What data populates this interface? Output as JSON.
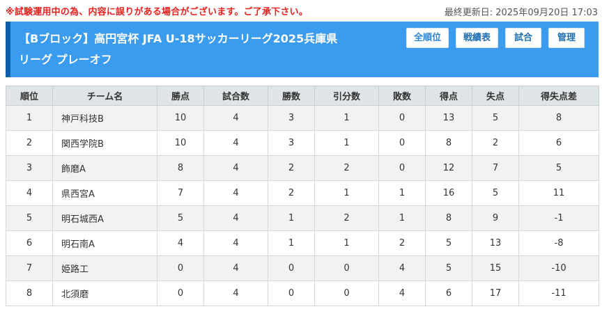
{
  "notice": "※試験運用中の為、内容に誤りがある場合がございます。ご了承下さい。",
  "last_updated": "最終更新日: 2025年09月20日 17:03",
  "header": {
    "title_line1": "【Bブロック】高円宮杯 JFA U-18サッカーリーグ2025兵庫県",
    "title_line2": "リーグ プレーオフ"
  },
  "nav": {
    "standings": "全順位",
    "results": "戦績表",
    "matches": "試合",
    "admin": "管理"
  },
  "table": {
    "headers": [
      "順位",
      "チーム名",
      "勝点",
      "試合数",
      "勝数",
      "引分数",
      "敗数",
      "得点",
      "失点",
      "得失点差"
    ],
    "rows": [
      [
        "1",
        "神戸科技B",
        "10",
        "4",
        "3",
        "1",
        "0",
        "13",
        "5",
        "8"
      ],
      [
        "2",
        "関西学院B",
        "10",
        "4",
        "3",
        "1",
        "0",
        "8",
        "2",
        "6"
      ],
      [
        "3",
        "飾磨A",
        "8",
        "4",
        "2",
        "2",
        "0",
        "12",
        "7",
        "5"
      ],
      [
        "4",
        "県西宮A",
        "7",
        "4",
        "2",
        "1",
        "1",
        "16",
        "5",
        "11"
      ],
      [
        "5",
        "明石城西A",
        "5",
        "4",
        "1",
        "2",
        "1",
        "8",
        "9",
        "-1"
      ],
      [
        "6",
        "明石南A",
        "4",
        "4",
        "1",
        "1",
        "2",
        "5",
        "13",
        "-8"
      ],
      [
        "7",
        "姫路工",
        "0",
        "4",
        "0",
        "0",
        "4",
        "5",
        "15",
        "-10"
      ],
      [
        "8",
        "北須磨",
        "0",
        "4",
        "0",
        "0",
        "4",
        "6",
        "17",
        "-11"
      ]
    ]
  },
  "colors": {
    "header_bg": "#3b9bef",
    "header_accent": "#0d5fa8",
    "warning": "#e8201e"
  }
}
